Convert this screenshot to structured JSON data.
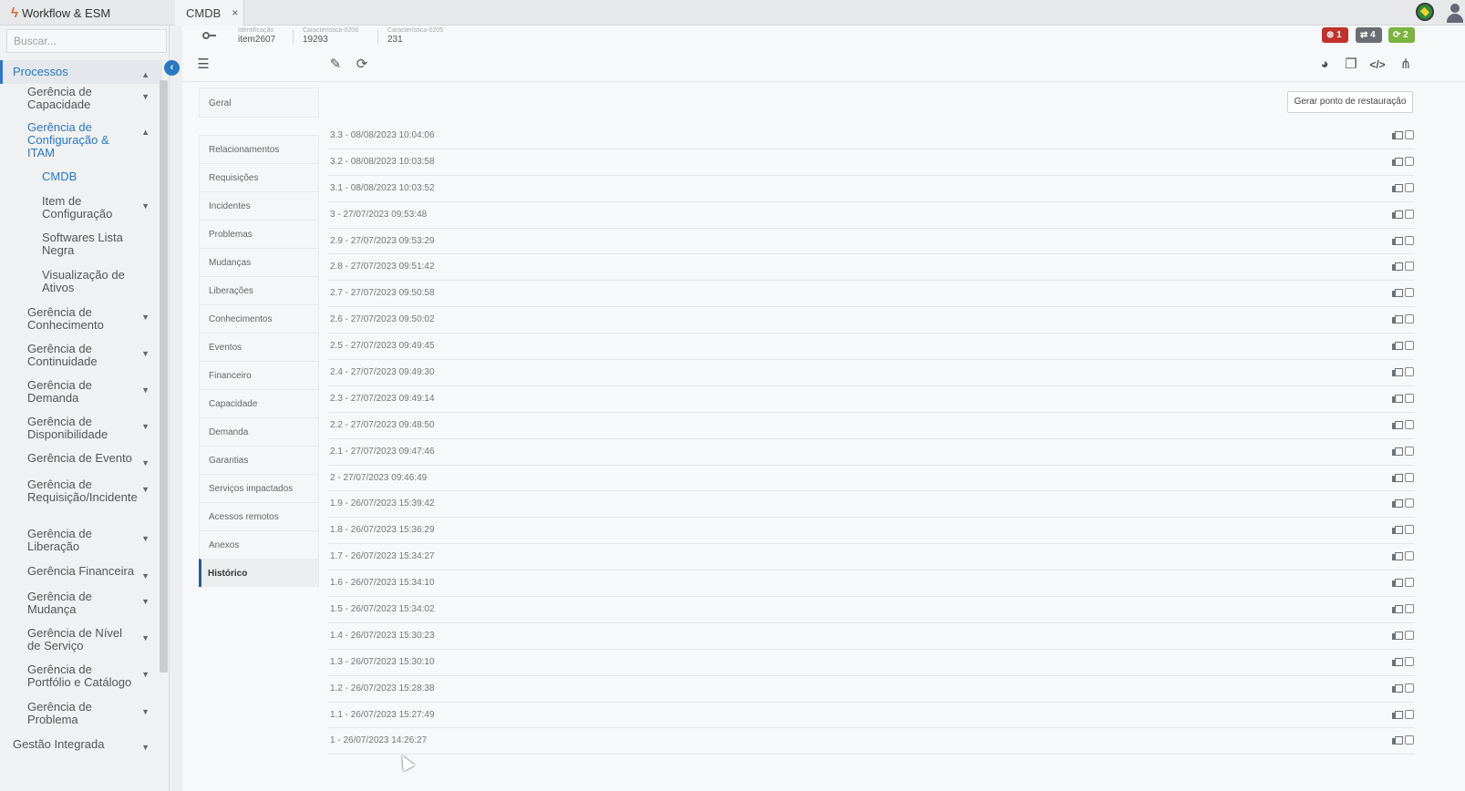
{
  "app": {
    "title": "Workflow & ESM",
    "tab_label": "CMDB",
    "tab_close": "×"
  },
  "search": {
    "placeholder": "Buscar..."
  },
  "sidebar": {
    "items": [
      {
        "label": "Processos",
        "level": 0,
        "chevron": "up",
        "active": true
      },
      {
        "label": "Gerência de Capacidade",
        "level": 1,
        "chevron": "down"
      },
      {
        "label": "Gerência de Configuração & ITAM",
        "level": 1,
        "chevron": "up",
        "open": true
      },
      {
        "label": "CMDB",
        "level": 2,
        "selected": true
      },
      {
        "label": "Item de Configuração",
        "level": 2,
        "chevron": "down"
      },
      {
        "label": "Softwares Lista Negra",
        "level": 2
      },
      {
        "label": "Visualização de Ativos",
        "level": 2
      },
      {
        "label": "Gerência de Conhecimento",
        "level": 1,
        "chevron": "down"
      },
      {
        "label": "Gerência de Continuidade",
        "level": 1,
        "chevron": "down"
      },
      {
        "label": "Gerência de Demanda",
        "level": 1,
        "chevron": "down"
      },
      {
        "label": "Gerência de Disponibilidade",
        "level": 1,
        "chevron": "down"
      },
      {
        "label": "Gerência de Evento",
        "level": 1,
        "chevron": "down"
      },
      {
        "label": "Gerência de Requisição/Incidente",
        "level": 1,
        "chevron": "down"
      },
      {
        "label": "Gerência de Liberação",
        "level": 1,
        "chevron": "down"
      },
      {
        "label": "Gerência Financeira",
        "level": 1,
        "chevron": "down"
      },
      {
        "label": "Gerência de Mudança",
        "level": 1,
        "chevron": "down"
      },
      {
        "label": "Gerência de Nível de Serviço",
        "level": 1,
        "chevron": "down"
      },
      {
        "label": "Gerência de Portfólio e Catálogo",
        "level": 1,
        "chevron": "down"
      },
      {
        "label": "Gerência de Problema",
        "level": 1,
        "chevron": "down"
      },
      {
        "label": "Gestão Integrada",
        "level": 0,
        "chevron": "down"
      }
    ]
  },
  "infobar": {
    "fields": [
      {
        "key": "Identificação",
        "value": "item2607"
      },
      {
        "key": "Característica-0208",
        "value": "19293"
      },
      {
        "key": "Característica-0205",
        "value": "231"
      }
    ],
    "badges": {
      "errors": "1",
      "transfers": "4",
      "sync": "2"
    }
  },
  "sections": [
    "Geral",
    "Relacionamentos",
    "Requisições",
    "Incidentes",
    "Problemas",
    "Mudanças",
    "Liberações",
    "Conhecimentos",
    "Eventos",
    "Financeiro",
    "Capacidade",
    "Demanda",
    "Garantias",
    "Serviços impactados",
    "Acessos remotos",
    "Anexos",
    "Histórico"
  ],
  "active_section": "Histórico",
  "restore_button": "Gerar ponto de restauração",
  "history": [
    "3.3 - 08/08/2023 10:04:06",
    "3.2 - 08/08/2023 10:03:58",
    "3.1 - 08/08/2023 10:03:52",
    "3 - 27/07/2023 09:53:48",
    "2.9 - 27/07/2023 09:53:29",
    "2.8 - 27/07/2023 09:51:42",
    "2.7 - 27/07/2023 09:50:58",
    "2.6 - 27/07/2023 09:50:02",
    "2.5 - 27/07/2023 09:49:45",
    "2.4 - 27/07/2023 09:49:30",
    "2.3 - 27/07/2023 09:49:14",
    "2.2 - 27/07/2023 09:48:50",
    "2.1 - 27/07/2023 09:47:46",
    "2 - 27/07/2023 09:46:49",
    "1.9 - 26/07/2023 15:39:42",
    "1.8 - 26/07/2023 15:36:29",
    "1.7 - 26/07/2023 15:34:27",
    "1.6 - 26/07/2023 15:34:10",
    "1.5 - 26/07/2023 15:34:02",
    "1.4 - 26/07/2023 15:30:23",
    "1.3 - 26/07/2023 15:30:10",
    "1.2 - 26/07/2023 15:28:38",
    "1.1 - 26/07/2023 15:27:49",
    "1 - 26/07/2023 14:26:27"
  ],
  "colors": {
    "accent": "#2a78c2",
    "error": "#c0322b",
    "success": "#7cb342"
  }
}
